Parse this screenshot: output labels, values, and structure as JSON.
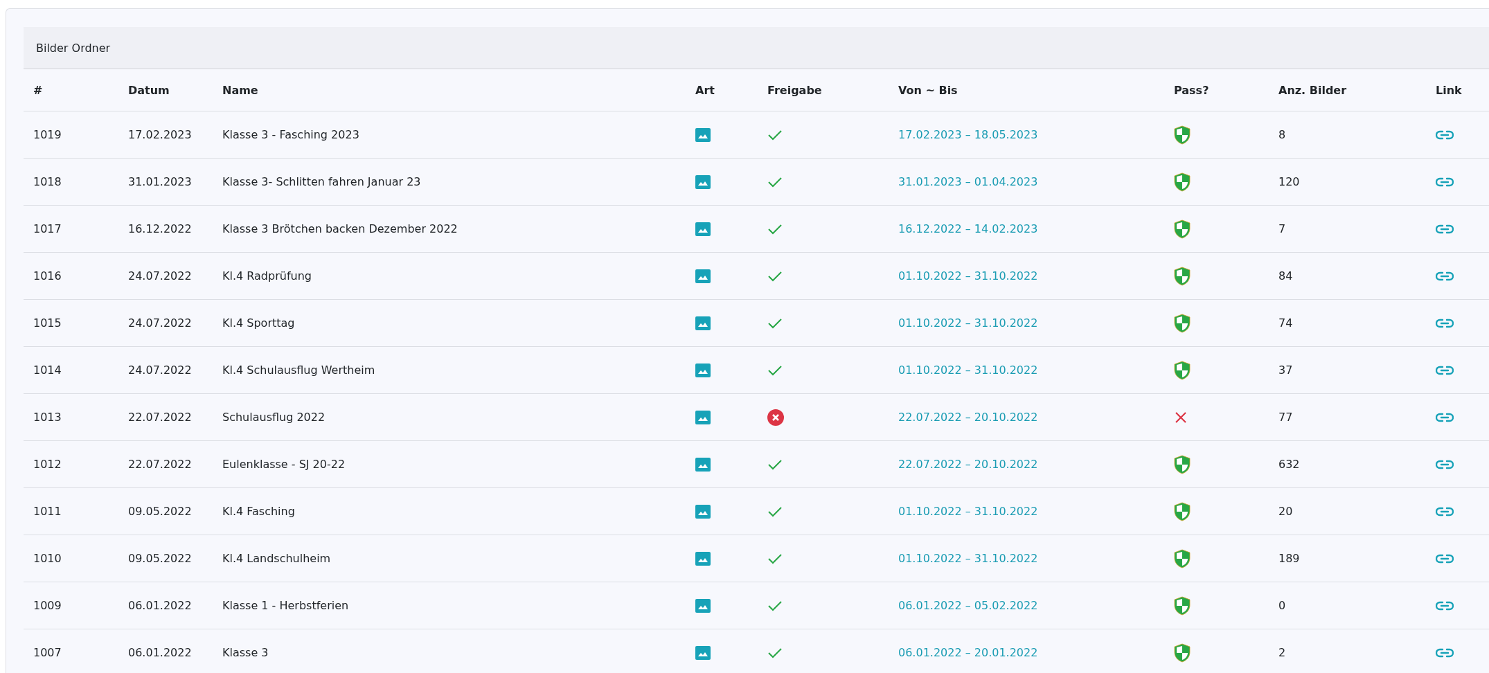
{
  "panel": {
    "title": "Bilder Ordner"
  },
  "table": {
    "columns": [
      "#",
      "Datum",
      "Name",
      "Art",
      "Freigabe",
      "Von ~ Bis",
      "Pass?",
      "Anz. Bilder",
      "Link"
    ],
    "rows": [
      {
        "id": "1019",
        "datum": "17.02.2023",
        "name": "Klasse 3 - Fasching 2023",
        "released": true,
        "range": "17.02.2023 – 18.05.2023",
        "protected": true,
        "count": "8"
      },
      {
        "id": "1018",
        "datum": "31.01.2023",
        "name": "Klasse 3- Schlitten fahren Januar 23",
        "released": true,
        "range": "31.01.2023 – 01.04.2023",
        "protected": true,
        "count": "120"
      },
      {
        "id": "1017",
        "datum": "16.12.2022",
        "name": "Klasse 3 Brötchen backen Dezember 2022",
        "released": true,
        "range": "16.12.2022 – 14.02.2023",
        "protected": true,
        "count": "7"
      },
      {
        "id": "1016",
        "datum": "24.07.2022",
        "name": "Kl.4 Radprüfung",
        "released": true,
        "range": "01.10.2022 – 31.10.2022",
        "protected": true,
        "count": "84"
      },
      {
        "id": "1015",
        "datum": "24.07.2022",
        "name": "Kl.4 Sporttag",
        "released": true,
        "range": "01.10.2022 – 31.10.2022",
        "protected": true,
        "count": "74"
      },
      {
        "id": "1014",
        "datum": "24.07.2022",
        "name": "Kl.4 Schulausflug Wertheim",
        "released": true,
        "range": "01.10.2022 – 31.10.2022",
        "protected": true,
        "count": "37"
      },
      {
        "id": "1013",
        "datum": "22.07.2022",
        "name": "Schulausflug 2022",
        "released": false,
        "range": "22.07.2022 – 20.10.2022",
        "protected": false,
        "count": "77"
      },
      {
        "id": "1012",
        "datum": "22.07.2022",
        "name": "Eulenklasse - SJ 20-22",
        "released": true,
        "range": "22.07.2022 – 20.10.2022",
        "protected": true,
        "count": "632"
      },
      {
        "id": "1011",
        "datum": "09.05.2022",
        "name": "Kl.4 Fasching",
        "released": true,
        "range": "01.10.2022 – 31.10.2022",
        "protected": true,
        "count": "20"
      },
      {
        "id": "1010",
        "datum": "09.05.2022",
        "name": "Kl.4 Landschulheim",
        "released": true,
        "range": "01.10.2022 – 31.10.2022",
        "protected": true,
        "count": "189"
      },
      {
        "id": "1009",
        "datum": "06.01.2022",
        "name": "Klasse 1 - Herbstferien",
        "released": true,
        "range": "06.01.2022 – 05.02.2022",
        "protected": true,
        "count": "0"
      },
      {
        "id": "1007",
        "datum": "06.01.2022",
        "name": "Klasse 3",
        "released": true,
        "range": "06.01.2022 – 20.01.2022",
        "protected": true,
        "count": "2"
      }
    ]
  }
}
